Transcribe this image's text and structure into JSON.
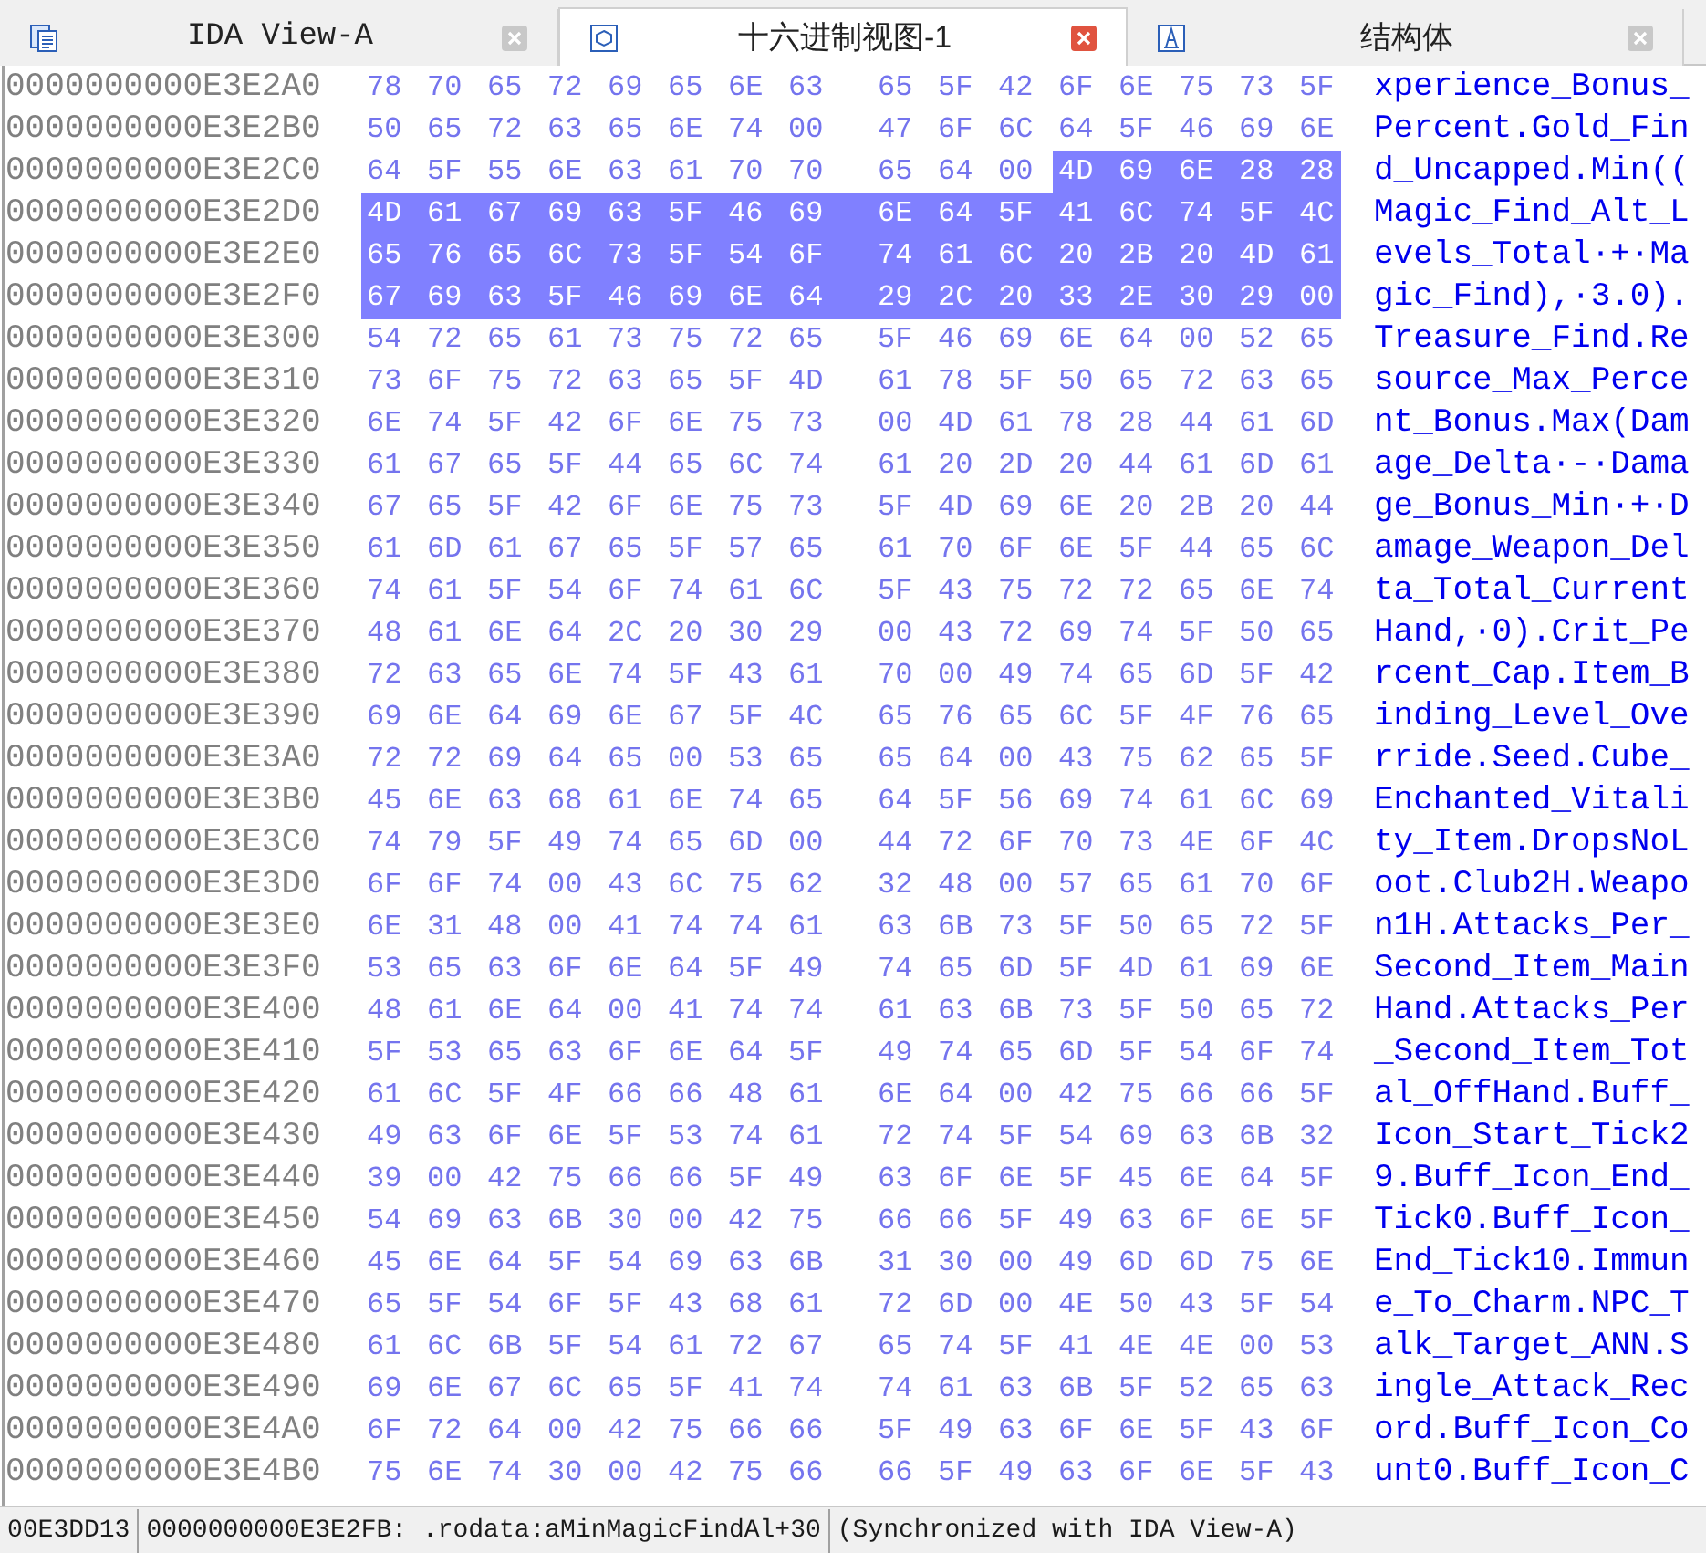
{
  "tabs": [
    {
      "label": "IDA View-A",
      "selected": false
    },
    {
      "label": "十六进制视图-1",
      "selected": true
    },
    {
      "label": "结构体",
      "selected": false
    }
  ],
  "rows": [
    {
      "address": "0000000000E3E2A0",
      "segments": [
        {
          "bytes": "78 70 65 72 69 65 6E 63 65 5F 42 6F 6E 75 73 5F",
          "selected": false
        }
      ],
      "ascii": "xperience_Bonus_"
    },
    {
      "address": "0000000000E3E2B0",
      "segments": [
        {
          "bytes": "50 65 72 63 65 6E 74 00 47 6F 6C 64 5F 46 69 6E",
          "selected": false
        }
      ],
      "ascii": "Percent.Gold_Fin"
    },
    {
      "address": "0000000000E3E2C0",
      "segments": [
        {
          "bytes": "64 5F 55 6E 63 61 70 70 65 64 00",
          "selected": false
        },
        {
          "bytes": "4D 69 6E 28 28",
          "selected": true
        }
      ],
      "ascii": "d_Uncapped.Min(("
    },
    {
      "address": "0000000000E3E2D0",
      "segments": [
        {
          "bytes": "4D 61 67 69 63 5F 46 69 6E 64 5F 41 6C 74 5F 4C",
          "selected": true
        }
      ],
      "ascii": "Magic_Find_Alt_L"
    },
    {
      "address": "0000000000E3E2E0",
      "segments": [
        {
          "bytes": "65 76 65 6C 73 5F 54 6F 74 61 6C 20 2B 20 4D 61",
          "selected": true
        }
      ],
      "ascii": "evels_Total·+·Ma"
    },
    {
      "address": "0000000000E3E2F0",
      "segments": [
        {
          "bytes": "67 69 63 5F 46 69 6E 64 29 2C 20 33 2E 30 29 00",
          "selected": true
        }
      ],
      "ascii": "gic_Find),·3.0)."
    },
    {
      "address": "0000000000E3E300",
      "segments": [
        {
          "bytes": "54 72 65 61 73 75 72 65 5F 46 69 6E 64 00 52 65",
          "selected": false
        }
      ],
      "ascii": "Treasure_Find.Re"
    },
    {
      "address": "0000000000E3E310",
      "segments": [
        {
          "bytes": "73 6F 75 72 63 65 5F 4D 61 78 5F 50 65 72 63 65",
          "selected": false
        }
      ],
      "ascii": "source_Max_Perce"
    },
    {
      "address": "0000000000E3E320",
      "segments": [
        {
          "bytes": "6E 74 5F 42 6F 6E 75 73 00 4D 61 78 28 44 61 6D",
          "selected": false
        }
      ],
      "ascii": "nt_Bonus.Max(Dam"
    },
    {
      "address": "0000000000E3E330",
      "segments": [
        {
          "bytes": "61 67 65 5F 44 65 6C 74 61 20 2D 20 44 61 6D 61",
          "selected": false
        }
      ],
      "ascii": "age_Delta·-·Dama"
    },
    {
      "address": "0000000000E3E340",
      "segments": [
        {
          "bytes": "67 65 5F 42 6F 6E 75 73 5F 4D 69 6E 20 2B 20 44",
          "selected": false
        }
      ],
      "ascii": "ge_Bonus_Min·+·D"
    },
    {
      "address": "0000000000E3E350",
      "segments": [
        {
          "bytes": "61 6D 61 67 65 5F 57 65 61 70 6F 6E 5F 44 65 6C",
          "selected": false
        }
      ],
      "ascii": "amage_Weapon_Del"
    },
    {
      "address": "0000000000E3E360",
      "segments": [
        {
          "bytes": "74 61 5F 54 6F 74 61 6C 5F 43 75 72 72 65 6E 74",
          "selected": false
        }
      ],
      "ascii": "ta_Total_Current"
    },
    {
      "address": "0000000000E3E370",
      "segments": [
        {
          "bytes": "48 61 6E 64 2C 20 30 29 00 43 72 69 74 5F 50 65",
          "selected": false
        }
      ],
      "ascii": "Hand,·0).Crit_Pe"
    },
    {
      "address": "0000000000E3E380",
      "segments": [
        {
          "bytes": "72 63 65 6E 74 5F 43 61 70 00 49 74 65 6D 5F 42",
          "selected": false
        }
      ],
      "ascii": "rcent_Cap.Item_B"
    },
    {
      "address": "0000000000E3E390",
      "segments": [
        {
          "bytes": "69 6E 64 69 6E 67 5F 4C 65 76 65 6C 5F 4F 76 65",
          "selected": false
        }
      ],
      "ascii": "inding_Level_Ove"
    },
    {
      "address": "0000000000E3E3A0",
      "segments": [
        {
          "bytes": "72 72 69 64 65 00 53 65 65 64 00 43 75 62 65 5F",
          "selected": false
        }
      ],
      "ascii": "rride.Seed.Cube_"
    },
    {
      "address": "0000000000E3E3B0",
      "segments": [
        {
          "bytes": "45 6E 63 68 61 6E 74 65 64 5F 56 69 74 61 6C 69",
          "selected": false
        }
      ],
      "ascii": "Enchanted_Vitali"
    },
    {
      "address": "0000000000E3E3C0",
      "segments": [
        {
          "bytes": "74 79 5F 49 74 65 6D 00 44 72 6F 70 73 4E 6F 4C",
          "selected": false
        }
      ],
      "ascii": "ty_Item.DropsNoL"
    },
    {
      "address": "0000000000E3E3D0",
      "segments": [
        {
          "bytes": "6F 6F 74 00 43 6C 75 62 32 48 00 57 65 61 70 6F",
          "selected": false
        }
      ],
      "ascii": "oot.Club2H.Weapo"
    },
    {
      "address": "0000000000E3E3E0",
      "segments": [
        {
          "bytes": "6E 31 48 00 41 74 74 61 63 6B 73 5F 50 65 72 5F",
          "selected": false
        }
      ],
      "ascii": "n1H.Attacks_Per_"
    },
    {
      "address": "0000000000E3E3F0",
      "segments": [
        {
          "bytes": "53 65 63 6F 6E 64 5F 49 74 65 6D 5F 4D 61 69 6E",
          "selected": false
        }
      ],
      "ascii": "Second_Item_Main"
    },
    {
      "address": "0000000000E3E400",
      "segments": [
        {
          "bytes": "48 61 6E 64 00 41 74 74 61 63 6B 73 5F 50 65 72",
          "selected": false
        }
      ],
      "ascii": "Hand.Attacks_Per"
    },
    {
      "address": "0000000000E3E410",
      "segments": [
        {
          "bytes": "5F 53 65 63 6F 6E 64 5F 49 74 65 6D 5F 54 6F 74",
          "selected": false
        }
      ],
      "ascii": "_Second_Item_Tot"
    },
    {
      "address": "0000000000E3E420",
      "segments": [
        {
          "bytes": "61 6C 5F 4F 66 66 48 61 6E 64 00 42 75 66 66 5F",
          "selected": false
        }
      ],
      "ascii": "al_OffHand.Buff_"
    },
    {
      "address": "0000000000E3E430",
      "segments": [
        {
          "bytes": "49 63 6F 6E 5F 53 74 61 72 74 5F 54 69 63 6B 32",
          "selected": false
        }
      ],
      "ascii": "Icon_Start_Tick2"
    },
    {
      "address": "0000000000E3E440",
      "segments": [
        {
          "bytes": "39 00 42 75 66 66 5F 49 63 6F 6E 5F 45 6E 64 5F",
          "selected": false
        }
      ],
      "ascii": "9.Buff_Icon_End_"
    },
    {
      "address": "0000000000E3E450",
      "segments": [
        {
          "bytes": "54 69 63 6B 30 00 42 75 66 66 5F 49 63 6F 6E 5F",
          "selected": false
        }
      ],
      "ascii": "Tick0.Buff_Icon_"
    },
    {
      "address": "0000000000E3E460",
      "segments": [
        {
          "bytes": "45 6E 64 5F 54 69 63 6B 31 30 00 49 6D 6D 75 6E",
          "selected": false
        }
      ],
      "ascii": "End_Tick10.Immun"
    },
    {
      "address": "0000000000E3E470",
      "segments": [
        {
          "bytes": "65 5F 54 6F 5F 43 68 61 72 6D 00 4E 50 43 5F 54",
          "selected": false
        }
      ],
      "ascii": "e_To_Charm.NPC_T"
    },
    {
      "address": "0000000000E3E480",
      "segments": [
        {
          "bytes": "61 6C 6B 5F 54 61 72 67 65 74 5F 41 4E 4E 00 53",
          "selected": false
        }
      ],
      "ascii": "alk_Target_ANN.S"
    },
    {
      "address": "0000000000E3E490",
      "segments": [
        {
          "bytes": "69 6E 67 6C 65 5F 41 74 74 61 63 6B 5F 52 65 63",
          "selected": false
        }
      ],
      "ascii": "ingle_Attack_Rec"
    },
    {
      "address": "0000000000E3E4A0",
      "segments": [
        {
          "bytes": "6F 72 64 00 42 75 66 66 5F 49 63 6F 6E 5F 43 6F",
          "selected": false
        }
      ],
      "ascii": "ord.Buff_Icon_Co"
    },
    {
      "address": "0000000000E3E4B0",
      "segments": [
        {
          "bytes": "75 6E 74 30 00 42 75 66 66 5F 49 63 6F 6E 5F 43",
          "selected": false
        }
      ],
      "ascii": "unt0.Buff_Icon_C"
    }
  ],
  "status_bar": {
    "offset": "00E3DD13",
    "location": "0000000000E3E2FB: .rodata:aMinMagicFindAl+30",
    "sync": "(Synchronized with IDA View-A)"
  }
}
